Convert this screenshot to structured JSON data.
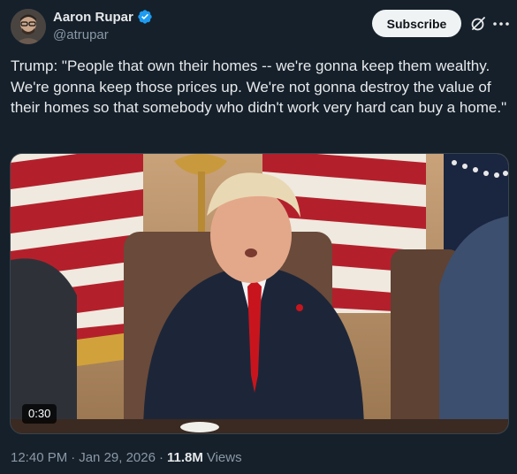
{
  "author": {
    "name": "Aaron Rupar",
    "handle": "@atrupar",
    "verified": true,
    "avatar_icon": "avatar-photo"
  },
  "header": {
    "subscribe_label": "Subscribe",
    "grok_icon": "grok-icon",
    "more_icon": "more-icon"
  },
  "tweet": {
    "text": "Trump: \"People that own their homes -- we're gonna keep them wealthy. We're gonna keep those prices up. We're not gonna destroy the value of their homes so that somebody who didn't work very hard can buy a home.\""
  },
  "media": {
    "duration": "0:30"
  },
  "meta": {
    "time": "12:40 PM",
    "separator1": "·",
    "date": "Jan 29, 2026",
    "separator2": "·",
    "views_count": "11.8M",
    "views_label": "Views"
  },
  "colors": {
    "background": "#15202b",
    "verified_blue": "#1d9bf0",
    "secondary_text": "#8b98a5"
  }
}
